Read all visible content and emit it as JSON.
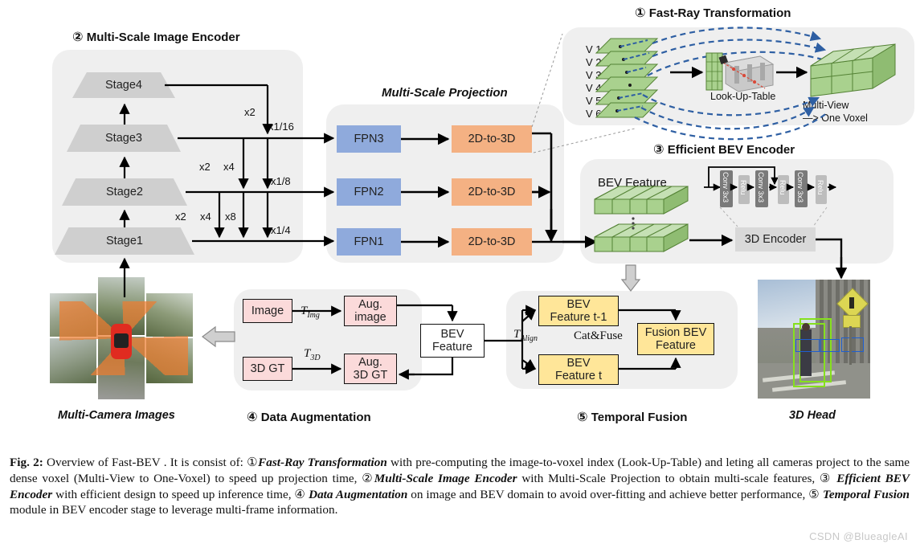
{
  "figure": {
    "id": "Fig. 2:",
    "caption_runs": [
      {
        "t": "Fig. 2:",
        "s": "b"
      },
      {
        "t": " Overview of Fast-BEV . It is consist of: ①",
        "s": "n"
      },
      {
        "t": "Fast-Ray Transformation",
        "s": "i"
      },
      {
        "t": " with pre-computing the image-to-voxel index (Look-Up-Table) and leting all cameras project to the same dense voxel (Multi-View to One-Voxel) to speed up projection time, ②",
        "s": "n"
      },
      {
        "t": "Multi-Scale Image Encoder",
        "s": "i"
      },
      {
        "t": " with Multi-Scale Projection to obtain multi-scale features, ③ ",
        "s": "n"
      },
      {
        "t": "Efficient BEV Encoder",
        "s": "i"
      },
      {
        "t": " with efficient design to speed up inference time, ④ ",
        "s": "n"
      },
      {
        "t": "Data Augmentation",
        "s": "i"
      },
      {
        "t": " on image and BEV domain to avoid over-fitting and achieve better performance, ⑤ ",
        "s": "n"
      },
      {
        "t": "Temporal Fusion",
        "s": "i"
      },
      {
        "t": " module in BEV encoder stage to leverage multi-frame information.",
        "s": "n"
      }
    ],
    "watermark": "CSDN @BlueagleAI"
  },
  "modules": {
    "fast_ray": {
      "number": "①",
      "title": "Fast-Ray Transformation",
      "views": [
        "V 1",
        "V 2",
        "V 3",
        "V 4",
        "V 5",
        "V 6"
      ],
      "lut_label": "Look-Up-Table",
      "voxel_label_line1": "Multi-View",
      "voxel_label_line2": "—> One Voxel"
    },
    "image_encoder": {
      "number": "②",
      "title": "Multi-Scale Image Encoder",
      "stages": [
        "Stage4",
        "Stage3",
        "Stage2",
        "Stage1"
      ],
      "upsample_labels": [
        "x2",
        "x2",
        "x4",
        "x2",
        "x4",
        "x8"
      ],
      "scale_labels": [
        "x1/16",
        "x1/8",
        "x1/4"
      ]
    },
    "projection": {
      "title": "Multi-Scale Projection",
      "fpn": [
        "FPN3",
        "FPN2",
        "FPN1"
      ],
      "proj": [
        "2D-to-3D",
        "2D-to-3D",
        "2D-to-3D"
      ]
    },
    "bev_encoder": {
      "number": "③",
      "title": "Efficient BEV  Encoder",
      "bev_feature_label": "BEV Feature",
      "encoder_label": "3D Encoder",
      "conv_blocks": [
        "Conv 3x3",
        "Relu",
        "Conv 3x3",
        "Relu",
        "Conv 3x3",
        "Relu"
      ]
    },
    "data_aug": {
      "number": "④",
      "title": "Data Augmentation",
      "image_label": "Image",
      "aug_image_label": "Aug.\nimage",
      "gt_label": "3D GT",
      "aug_gt_label": "Aug.\n3D GT",
      "t_img": "T",
      "t_img_sub": "Img",
      "t_3d": "T",
      "t_3d_sub": "3D",
      "bev_feature_label": "BEV\nFeature"
    },
    "temporal": {
      "number": "⑤",
      "title": "Temporal Fusion",
      "t_align": "T",
      "t_align_sub": "Align",
      "catfuse": "Cat&Fuse",
      "bev_t_1": "BEV\nFeature t-1",
      "bev_t": "BEV\nFeature t",
      "fusion": "Fusion BEV\nFeature"
    }
  },
  "labels": {
    "multi_camera": "Multi-Camera Images",
    "head": "3D Head"
  },
  "colors": {
    "panel": "#efefef",
    "fpn_blue": "#8faadc",
    "proj_orange": "#f4b183",
    "pink": "#fbdada",
    "yellow": "#ffe699",
    "gray_block": "#d9d9d9",
    "voxel_green": "#a9d18e",
    "dash_blue": "#2e5fa3"
  }
}
